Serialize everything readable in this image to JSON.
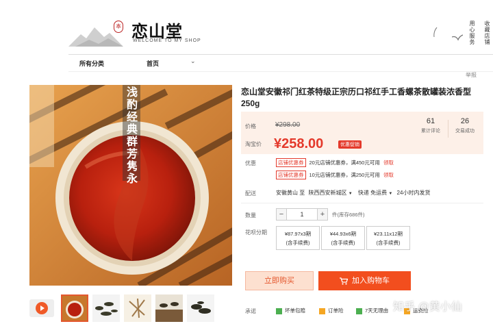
{
  "header": {
    "seal_text": "本",
    "shop_name": "恋山堂",
    "welcome": "WELCOME TO MY SHOP",
    "service_label": "用心服务",
    "favorite_label": "收藏店铺"
  },
  "nav": {
    "all_categories": "所有分类",
    "home": "首页",
    "report": "举报"
  },
  "product": {
    "title": "恋山堂安徽祁门红茶特级正宗历口祁红手工香螺茶散罐装浓香型250g",
    "image_overlay_text": "浅酌经典群芳隽永",
    "price_label": "价格",
    "original_price": "¥298.00",
    "taobao_price_label": "淘宝价",
    "current_price": "¥258.00",
    "promo_tag": "优惠促销",
    "stats": [
      {
        "value": "61",
        "label": "累计评论"
      },
      {
        "value": "26",
        "label": "交易成功"
      }
    ],
    "coupons_label": "优惠",
    "coupons": [
      {
        "tag": "店铺优惠券",
        "text": "20元店铺优惠券，满450元可用",
        "action": "领取"
      },
      {
        "tag": "店铺优惠券",
        "text": "10元店铺优惠券，满250元可用",
        "action": "领取"
      }
    ],
    "shipping_label": "配送",
    "shipping": {
      "from": "安徽黄山 至",
      "to": "陕西西安新城区",
      "method": "快递 免运费",
      "time": "24小时内发货"
    },
    "quantity_label": "数量",
    "quantity": "1",
    "minus": "−",
    "plus": "+",
    "stock": "件(库存686件)",
    "installment_label": "花呗分期",
    "installments": [
      {
        "amount": "¥87.97x3期",
        "fee": "(含手续费)"
      },
      {
        "amount": "¥44.93x6期",
        "fee": "(含手续费)"
      },
      {
        "amount": "¥23.11x12期",
        "fee": "(含手续费)"
      }
    ],
    "buy_now": "立即购买",
    "add_to_cart": "加入购物车",
    "promise_label": "承诺",
    "promises": [
      "坏单包赔",
      "订单险",
      "7天无理由",
      "运费险"
    ]
  },
  "watermark": "知乎 @黄小仙",
  "colors": {
    "accent": "#e4392b",
    "cart_button": "#f24e1e",
    "buy_button_bg": "#fde0d0",
    "price_box_bg": "#fdf0e8"
  }
}
